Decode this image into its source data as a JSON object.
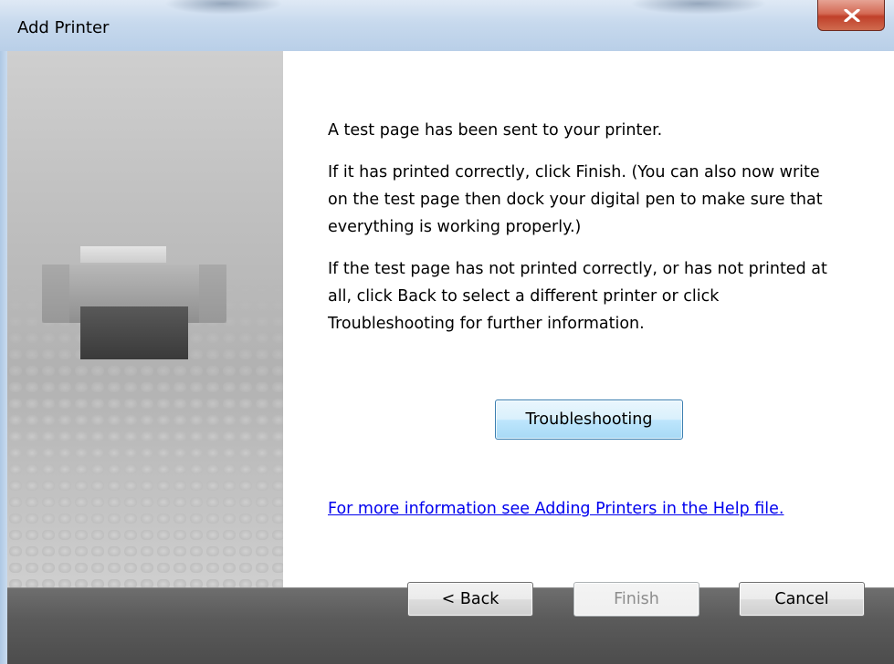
{
  "window": {
    "title": "Add Printer",
    "close_icon": "close-x-icon"
  },
  "wizard": {
    "art_icon": "printer-icon",
    "paragraph1": "A test page has been sent to your printer.",
    "paragraph2": "If it has printed correctly, click Finish. (You can also now write on the test page then dock your digital pen to make sure that everything is working properly.)",
    "paragraph3": "If the test page has not printed correctly, or has not printed at all, click Back to select a different printer or click Troubleshooting for further information.",
    "troubleshooting_label": "Troubleshooting",
    "help_link": "For more information see Adding Printers in the Help file."
  },
  "footer": {
    "back_label": "< Back",
    "finish_label": "Finish",
    "cancel_label": "Cancel"
  },
  "colors": {
    "link": "#0000ee",
    "close_button": "#c7442e",
    "footer": "#5b5b5b"
  }
}
